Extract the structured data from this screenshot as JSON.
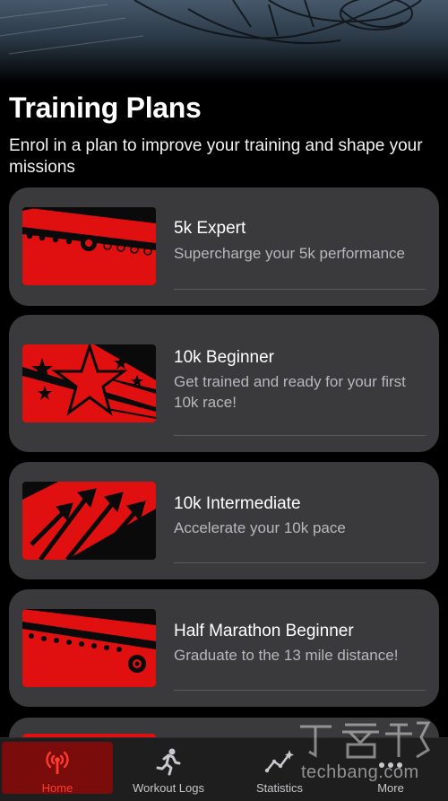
{
  "header": {
    "title": "Training Plans",
    "subtitle": "Enrol in a plan to improve your training and shape your missions"
  },
  "plans": [
    {
      "title": "5k Expert",
      "description": "Supercharge your 5k performance",
      "icon": "5k-expert-thumbnail"
    },
    {
      "title": "10k Beginner",
      "description": "Get trained and ready for your first 10k race!",
      "icon": "10k-beginner-thumbnail"
    },
    {
      "title": "10k Intermediate",
      "description": "Accelerate your 10k pace",
      "icon": "10k-intermediate-thumbnail"
    },
    {
      "title": "Half Marathon Beginner",
      "description": "Graduate to the 13 mile distance!",
      "icon": "half-marathon-beginner-thumbnail"
    }
  ],
  "tabbar": {
    "tabs": [
      {
        "label": "Home",
        "icon": "radio-signal-icon",
        "active": true
      },
      {
        "label": "Workout Logs",
        "icon": "runner-icon",
        "active": false
      },
      {
        "label": "Statistics",
        "icon": "chart-icon",
        "active": false
      },
      {
        "label": "More",
        "icon": "more-icon",
        "active": false
      }
    ]
  },
  "watermark": {
    "text": "techbang.com"
  },
  "colors": {
    "accent": "#e01010",
    "card": "#3a3a3c",
    "active_tab": "#7a0c0c"
  }
}
